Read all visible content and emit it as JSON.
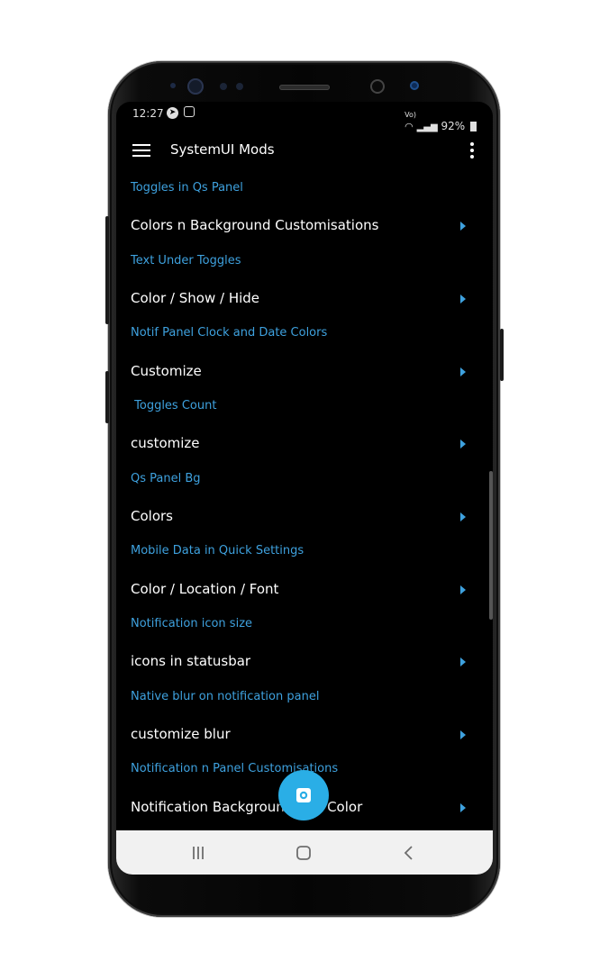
{
  "status_bar": {
    "time": "12:27",
    "notification_icons": [
      "telegram-icon",
      "instagram-icon"
    ],
    "battery": "92%"
  },
  "app_bar": {
    "title": "SystemUI Mods"
  },
  "sections": [
    {
      "header": "Toggles in Qs Panel",
      "item": "Colors n Background Customisations"
    },
    {
      "header": "Text Under Toggles",
      "item": "Color / Show / Hide"
    },
    {
      "header": "Notif Panel Clock and Date Colors",
      "item": "Customize"
    },
    {
      "header": " Toggles Count",
      "item": "customize"
    },
    {
      "header": "Qs Panel Bg",
      "item": "Colors"
    },
    {
      "header": "Mobile Data in Quick Settings",
      "item": "Color / Location / Font"
    },
    {
      "header": "Notification icon size",
      "item": "icons in statusbar"
    },
    {
      "header": "Native blur on notification panel",
      "item": "customize blur"
    },
    {
      "header": "Notification n Panel Customisations",
      "item": "Notification Background and Color"
    }
  ],
  "colors": {
    "accent": "#3ea1de",
    "fab": "#2aaee6",
    "background": "#000000"
  }
}
